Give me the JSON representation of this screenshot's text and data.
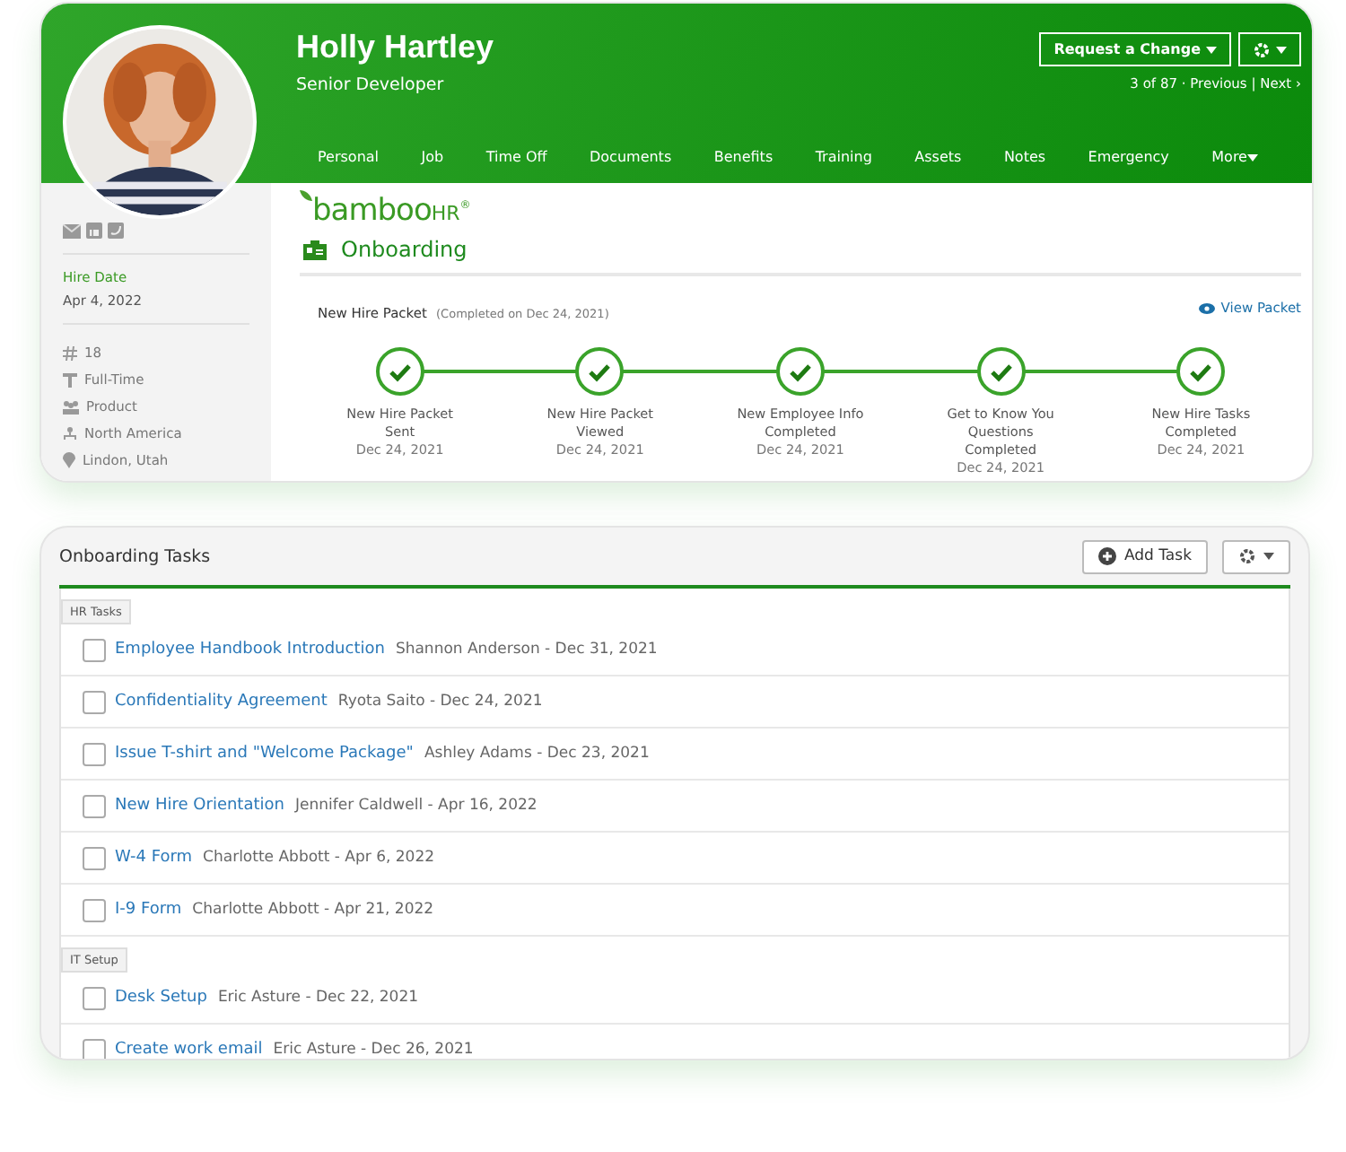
{
  "profile": {
    "name": "Holly Hartley",
    "job_title": "Senior Developer",
    "request_button": "Request a Change",
    "pager": {
      "position": "3 of 87 · ",
      "previous": "Previous",
      "separator": " | ",
      "next": "Next ›"
    }
  },
  "nav_tabs": [
    {
      "label": "Personal",
      "selected": false
    },
    {
      "label": "Job",
      "selected": false
    },
    {
      "label": "Time Off",
      "selected": false
    },
    {
      "label": "Documents",
      "selected": false
    },
    {
      "label": "Benefits",
      "selected": false
    },
    {
      "label": "Training",
      "selected": false
    },
    {
      "label": "Assets",
      "selected": false
    },
    {
      "label": "Notes",
      "selected": false
    },
    {
      "label": "Emergency",
      "selected": false
    },
    {
      "label": "More",
      "selected": false
    }
  ],
  "sidebar": {
    "hire_date_label": "Hire Date",
    "hire_date": "Apr 4, 2022",
    "details": [
      {
        "kind": "number",
        "text": "18"
      },
      {
        "kind": "type",
        "text": "Full-Time"
      },
      {
        "kind": "department",
        "text": "Product"
      },
      {
        "kind": "division",
        "text": "North America"
      },
      {
        "kind": "location",
        "text": "Lindon, Utah"
      }
    ]
  },
  "logo": {
    "word": "bamboo",
    "suffix": "HR",
    "mark": "®"
  },
  "section_title": "Onboarding",
  "packet": {
    "title": "New Hire Packet",
    "note": "(Completed on Dec 24, 2021)",
    "view_link": "View Packet",
    "steps": [
      {
        "label": "New Hire Packet Sent",
        "date": "Dec 24, 2021",
        "done": true
      },
      {
        "label": "New Hire Packet Viewed",
        "date": "Dec 24, 2021",
        "done": true
      },
      {
        "label": "New Employee Info Completed",
        "date": "Dec 24, 2021",
        "done": true
      },
      {
        "label": "Get to Know You Questions Completed",
        "date": "Dec 24, 2021",
        "done": true
      },
      {
        "label": "New Hire Tasks Completed",
        "date": "Dec 24, 2021",
        "done": true
      }
    ]
  },
  "tasks": {
    "title": "Onboarding Tasks",
    "add_button": "Add Task",
    "groups": [
      {
        "name": "HR Tasks",
        "items": [
          {
            "title": "Employee Handbook Introduction",
            "meta": "Shannon Anderson - Dec 31, 2021",
            "checked": false
          },
          {
            "title": "Confidentiality Agreement",
            "meta": "Ryota Saito - Dec 24, 2021",
            "checked": false
          },
          {
            "title": "Issue T-shirt and \"Welcome Package\"",
            "meta": "Ashley Adams - Dec 23, 2021",
            "checked": false
          },
          {
            "title": "New Hire Orientation",
            "meta": "Jennifer Caldwell - Apr 16, 2022",
            "checked": false
          },
          {
            "title": "W-4 Form",
            "meta": "Charlotte Abbott - Apr 6, 2022",
            "checked": false
          },
          {
            "title": "I-9 Form",
            "meta": "Charlotte Abbott - Apr 21, 2022",
            "checked": false
          }
        ]
      },
      {
        "name": "IT Setup",
        "items": [
          {
            "title": "Desk Setup",
            "meta": "Eric Asture - Dec 22, 2021",
            "checked": false
          },
          {
            "title": "Create work email",
            "meta": "Eric Asture - Dec 26, 2021",
            "checked": false
          }
        ]
      }
    ]
  }
}
